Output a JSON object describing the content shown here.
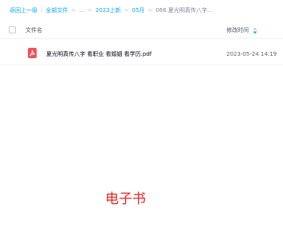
{
  "breadcrumb": {
    "back": "返回上一级",
    "all_files": "全部文件",
    "ellipsis": "...",
    "folder_1": "2023上新",
    "folder_2": "05月",
    "current": "066.夏光明真传八字...",
    "separator_pipe": "|",
    "separator_arrow": ">"
  },
  "table": {
    "col_name": "文件名",
    "col_time": "修改时间",
    "sort_icon": "sort-arrows-icon"
  },
  "files": [
    {
      "icon": "pdf-icon",
      "icon_color": "#f2515a",
      "name": "夏光明真传八字 看职业 看婚姻 看学历.pdf",
      "modified": "2023-05-24 14:19"
    }
  ],
  "overlay": {
    "label": "电子书",
    "color": "#e8231d"
  },
  "colors": {
    "link": "#06a7ff",
    "muted": "#818999"
  }
}
